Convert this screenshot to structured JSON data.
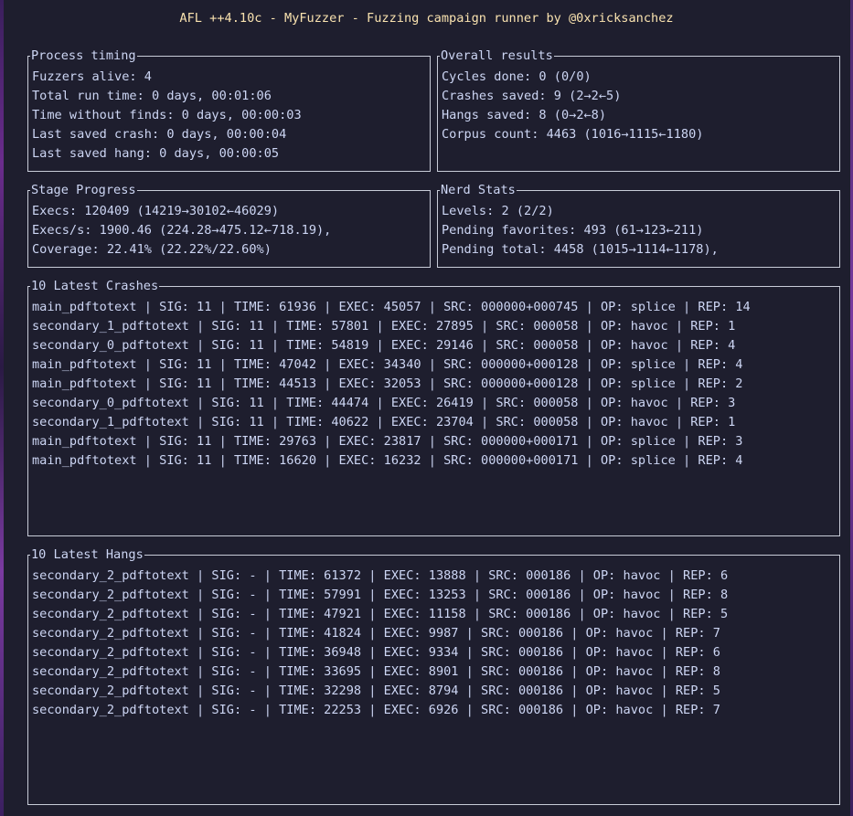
{
  "title": "AFL ++4.10c - MyFuzzer - Fuzzing campaign runner by @0xricksanchez",
  "process_timing": {
    "title": "Process timing",
    "lines": [
      "Fuzzers alive: 4",
      "Total run time: 0 days, 00:01:06",
      "Time without finds: 0 days, 00:00:03",
      "Last saved crash: 0 days, 00:00:04",
      "Last saved hang: 0 days, 00:00:05"
    ]
  },
  "overall_results": {
    "title": "Overall results",
    "lines": [
      "Cycles done: 0 (0/0)",
      "Crashes saved: 9 (2→2←5)",
      "Hangs saved: 8 (0→2←8)",
      "Corpus count: 4463 (1016→1115←1180)"
    ]
  },
  "stage_progress": {
    "title": "Stage Progress",
    "lines": [
      "Execs: 120409 (14219→30102←46029)",
      "Execs/s: 1900.46 (224.28→475.12←718.19),",
      "Coverage: 22.41% (22.22%/22.60%)"
    ]
  },
  "nerd_stats": {
    "title": "Nerd Stats",
    "lines": [
      "Levels: 2 (2/2)",
      "Pending favorites: 493 (61→123←211)",
      "Pending total: 4458 (1015→1114←1178),"
    ]
  },
  "crashes": {
    "title": "10 Latest Crashes",
    "rows": [
      "main_pdftotext | SIG: 11 | TIME: 61936 | EXEC: 45057 | SRC: 000000+000745 | OP: splice | REP: 14",
      "secondary_1_pdftotext | SIG: 11 | TIME: 57801 | EXEC: 27895 | SRC: 000058 | OP: havoc | REP: 1",
      "secondary_0_pdftotext | SIG: 11 | TIME: 54819 | EXEC: 29146 | SRC: 000058 | OP: havoc | REP: 4",
      "main_pdftotext | SIG: 11 | TIME: 47042 | EXEC: 34340 | SRC: 000000+000128 | OP: splice | REP: 4",
      "main_pdftotext | SIG: 11 | TIME: 44513 | EXEC: 32053 | SRC: 000000+000128 | OP: splice | REP: 2",
      "secondary_0_pdftotext | SIG: 11 | TIME: 44474 | EXEC: 26419 | SRC: 000058 | OP: havoc | REP: 3",
      "secondary_1_pdftotext | SIG: 11 | TIME: 40622 | EXEC: 23704 | SRC: 000058 | OP: havoc | REP: 1",
      "main_pdftotext | SIG: 11 | TIME: 29763 | EXEC: 23817 | SRC: 000000+000171 | OP: splice | REP: 3",
      "main_pdftotext | SIG: 11 | TIME: 16620 | EXEC: 16232 | SRC: 000000+000171 | OP: splice | REP: 4"
    ]
  },
  "hangs": {
    "title": "10 Latest Hangs",
    "rows": [
      "secondary_2_pdftotext | SIG: - | TIME: 61372 | EXEC: 13888 | SRC: 000186 | OP: havoc | REP: 6",
      "secondary_2_pdftotext | SIG: - | TIME: 57991 | EXEC: 13253 | SRC: 000186 | OP: havoc | REP: 8",
      "secondary_2_pdftotext | SIG: - | TIME: 47921 | EXEC: 11158 | SRC: 000186 | OP: havoc | REP: 5",
      "secondary_2_pdftotext | SIG: - | TIME: 41824 | EXEC: 9987 | SRC: 000186 | OP: havoc | REP: 7",
      "secondary_2_pdftotext | SIG: - | TIME: 36948 | EXEC: 9334 | SRC: 000186 | OP: havoc | REP: 6",
      "secondary_2_pdftotext | SIG: - | TIME: 33695 | EXEC: 8901 | SRC: 000186 | OP: havoc | REP: 8",
      "secondary_2_pdftotext | SIG: - | TIME: 32298 | EXEC: 8794 | SRC: 000186 | OP: havoc | REP: 5",
      "secondary_2_pdftotext | SIG: - | TIME: 22253 | EXEC: 6926 | SRC: 000186 | OP: havoc | REP: 7"
    ]
  }
}
